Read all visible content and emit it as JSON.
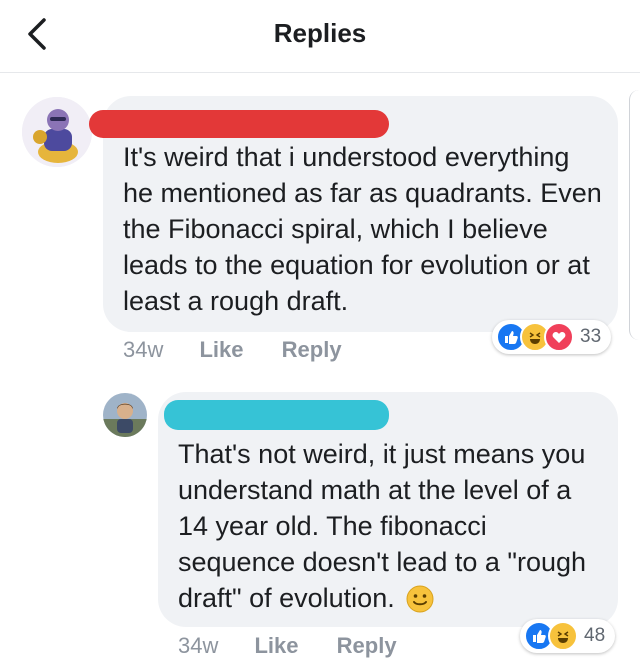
{
  "header": {
    "title": "Replies"
  },
  "comments": [
    {
      "text": "It's weird that i understood everything he mentioned as far as quadrants. Even the Fibonacci spiral, which I believe leads to the equation for evolution or at least a rough draft.",
      "time": "34w",
      "like_label": "Like",
      "reply_label": "Reply",
      "reaction_count": "33",
      "reactions": [
        "like-icon",
        "haha-icon",
        "love-icon"
      ],
      "redaction_color": "#e33838"
    },
    {
      "text": "That's not weird, it just means you understand math at the level of a 14 year old. The fibonacci sequence doesn't lead to a \"rough draft\" of evolution.",
      "emoji": "smile-emoji",
      "time": "34w",
      "like_label": "Like",
      "reply_label": "Reply",
      "reaction_count": "48",
      "reactions": [
        "like-icon",
        "haha-icon"
      ],
      "redaction_color": "#36c3d6"
    }
  ],
  "colors": {
    "like_blue": "#1877f2",
    "haha_yellow": "#f7c23c",
    "love_red": "#f0405a",
    "bubble_bg": "#f0f2f5",
    "meta_gray": "#8d949e"
  }
}
